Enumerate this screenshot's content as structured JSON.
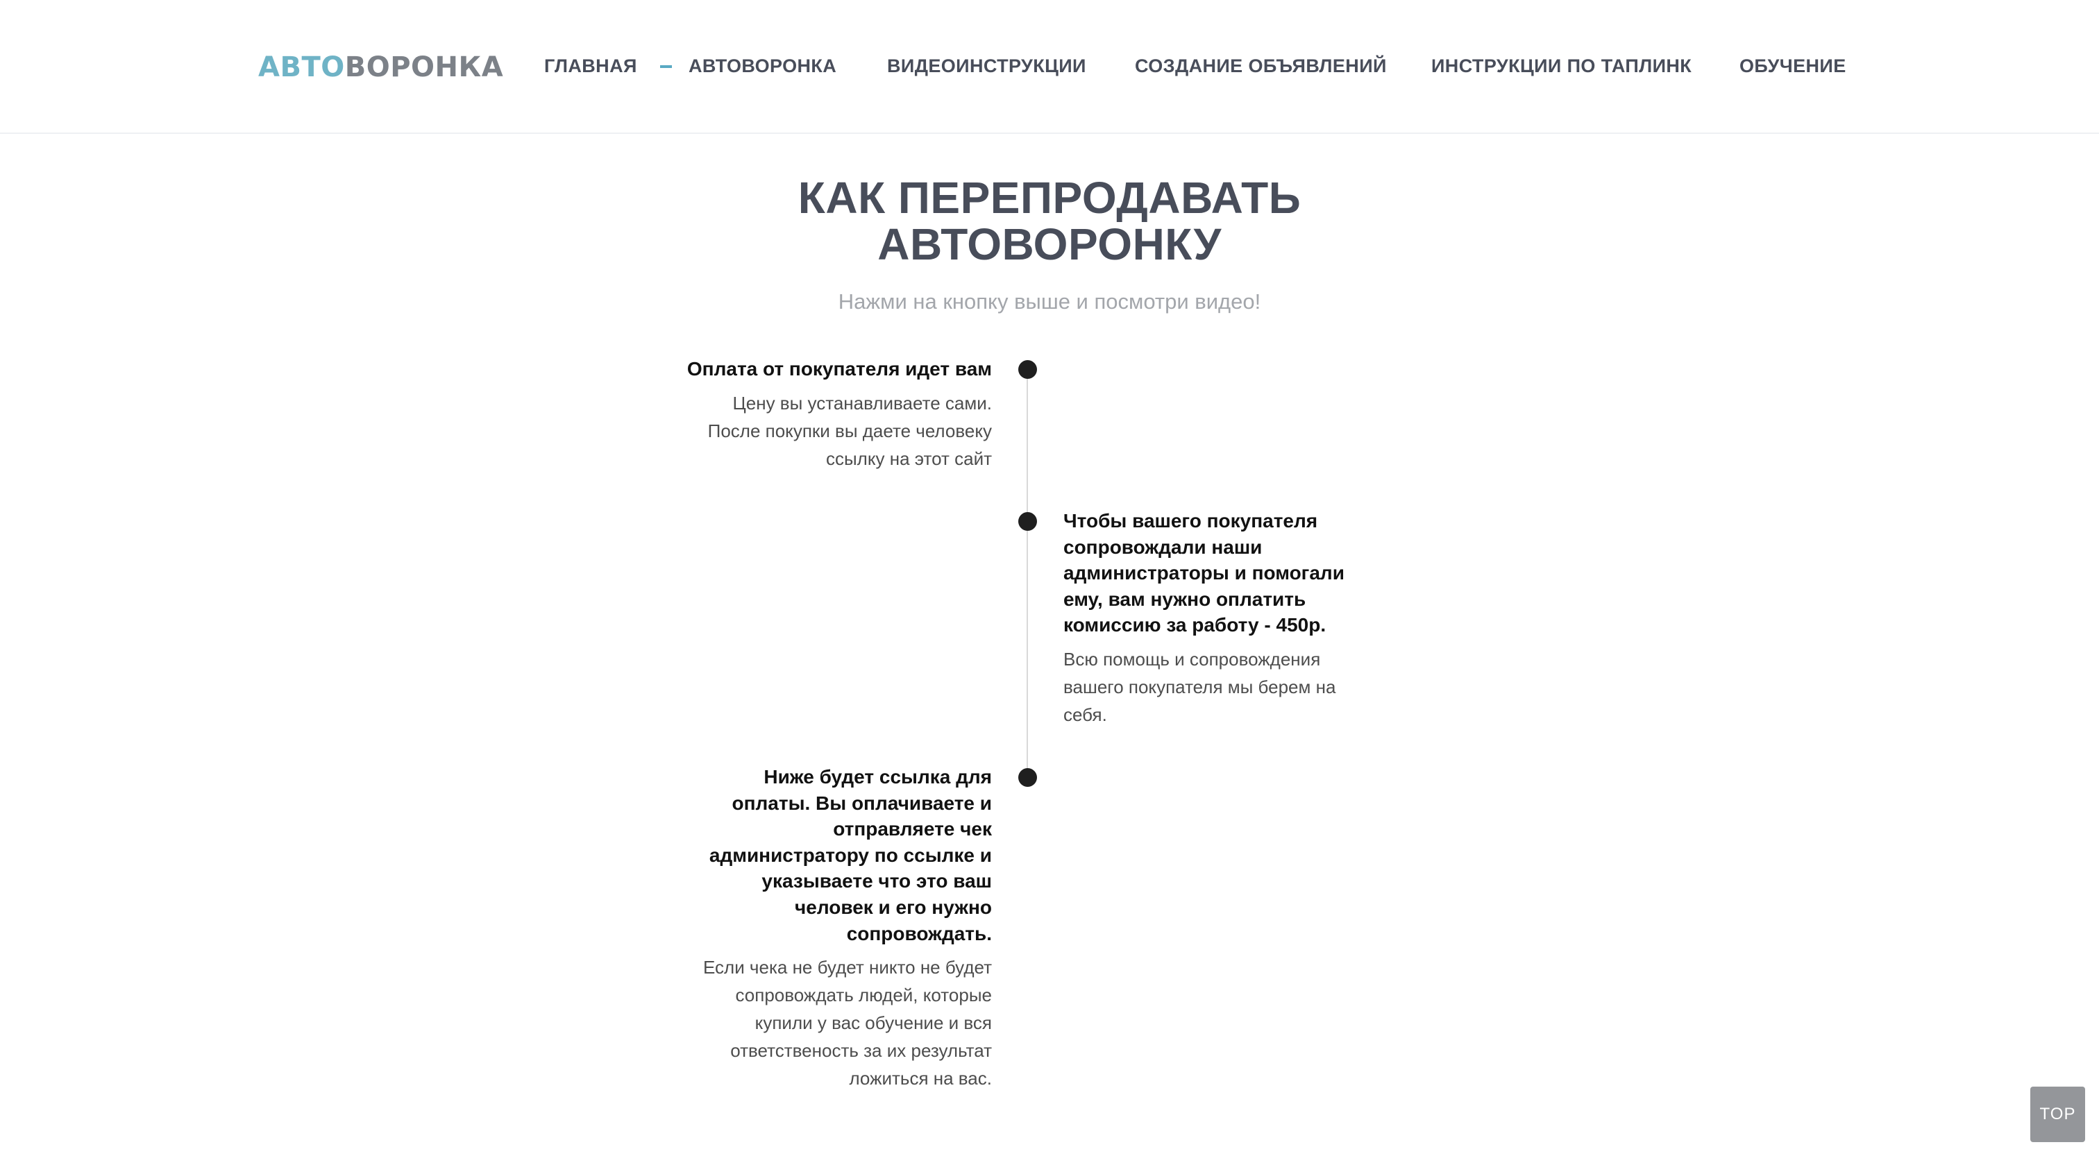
{
  "header": {
    "logo": {
      "part1": "АВТО",
      "part2": "ВОРОНКА"
    },
    "nav": [
      {
        "label": "ГЛАВНАЯ"
      },
      {
        "label": "АВТОВОРОНКА"
      },
      {
        "label": "ВИДЕОИНСТРУКЦИИ"
      },
      {
        "label": "СОЗДАНИЕ ОБЪЯВЛЕНИЙ"
      },
      {
        "label": "ИНСТРУКЦИИ ПО ТАПЛИНК"
      },
      {
        "label": "ОБУЧЕНИЕ"
      }
    ]
  },
  "hero": {
    "title_line1": "КАК ПЕРЕПРОДАВАТЬ",
    "title_line2": "АВТОВОРОНКУ",
    "subtitle": "Нажми на кнопку выше и посмотри видео!"
  },
  "timeline": [
    {
      "title": "Оплата от покупателя идет вам",
      "text": "Цену вы устанавливаете сами. После покупки вы даете человеку ссылку на этот сайт"
    },
    {
      "title": "Чтобы вашего покупателя сопровождали наши администраторы и помогали ему, вам нужно оплатить комиссию за работу - 450р.",
      "text": "Всю помощь и сопровождения вашего покупателя мы берем на себя."
    },
    {
      "title": "Ниже будет ссылка для оплаты. Вы оплачиваете и отправляете чек администратору по ссылке и указываете что это ваш человек и его нужно сопровождать.",
      "text": "Если чека не будет никто не будет сопровождать людей, которые купили у вас обучение и вся ответственость за их результат ложиться на вас."
    }
  ],
  "top_button": {
    "label": "TOP"
  },
  "colors": {
    "accent": "#59a9c3",
    "logo_auto": "#6fb3c6",
    "logo_funnel": "#7c8188",
    "nav_text": "#484d5a",
    "heading": "#484d5a",
    "subtitle": "#a3a6ab",
    "timeline_dot": "#1f1f1f",
    "timeline_line": "#d9d9d9",
    "top_button_bg": "#94969a"
  }
}
